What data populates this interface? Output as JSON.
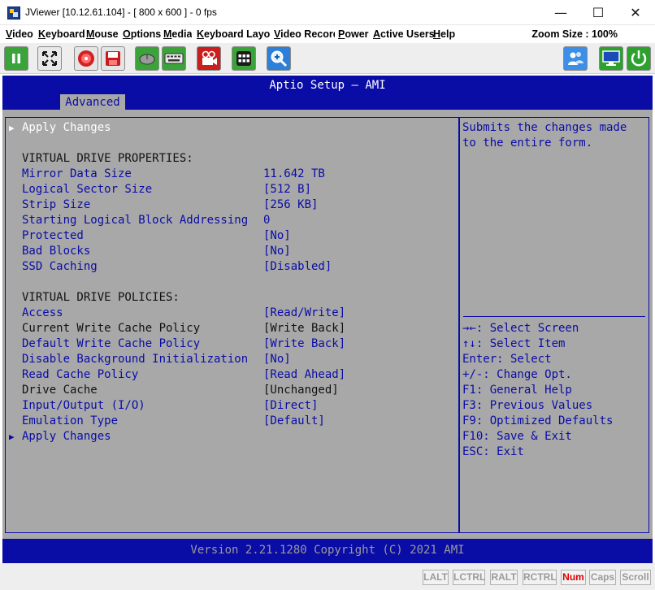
{
  "window": {
    "title": "JViewer [10.12.61.104] - [ 800 x 600 ] - 0 fps",
    "minimize_glyph": "—",
    "maximize_glyph": "☐",
    "close_glyph": "✕"
  },
  "menu": {
    "items": [
      "Video",
      "Keyboard",
      "Mouse",
      "Options",
      "Media",
      "Keyboard Layout",
      "Video Record",
      "Power",
      "Active Users",
      "Help"
    ],
    "zoom": "Zoom Size : 100%"
  },
  "toolbar": {
    "icons": [
      "pause-icon",
      "fullscreen-icon",
      "cd-media-icon",
      "floppy-media-icon",
      "mouse-icon",
      "keyboard-icon",
      "video-record-icon",
      "macro-keys-icon",
      "zoom-icon",
      "users-icon",
      "display-icon",
      "power-icon"
    ]
  },
  "bios": {
    "header": "Aptio Setup – AMI",
    "tab": "Advanced",
    "rows": [
      {
        "label": "Apply Changes",
        "value": "",
        "arrow": true,
        "color": "white"
      },
      {
        "label": "VIRTUAL DRIVE PROPERTIES:",
        "value": "",
        "arrow": false,
        "color": "black"
      },
      {
        "label": "Mirror Data Size",
        "value": "11.642 TB",
        "arrow": false,
        "color": "blue"
      },
      {
        "label": "Logical Sector Size",
        "value": "[512 B]",
        "arrow": false,
        "color": "blue"
      },
      {
        "label": "Strip Size",
        "value": "[256 KB]",
        "arrow": false,
        "color": "blue"
      },
      {
        "label": "Starting Logical Block Addressing",
        "value": "0",
        "arrow": false,
        "color": "blue"
      },
      {
        "label": "Protected",
        "value": "[No]",
        "arrow": false,
        "color": "blue"
      },
      {
        "label": "Bad Blocks",
        "value": "[No]",
        "arrow": false,
        "color": "blue"
      },
      {
        "label": "SSD Caching",
        "value": "[Disabled]",
        "arrow": false,
        "color": "blue"
      },
      {
        "label": "VIRTUAL DRIVE POLICIES:",
        "value": "",
        "arrow": false,
        "color": "black"
      },
      {
        "label": "Access",
        "value": "[Read/Write]",
        "arrow": false,
        "color": "blue"
      },
      {
        "label": "Current Write Cache Policy",
        "value": "[Write Back]",
        "arrow": false,
        "color": "black"
      },
      {
        "label": "Default Write Cache Policy",
        "value": "[Write Back]",
        "arrow": false,
        "color": "blue"
      },
      {
        "label": "Disable Background Initialization",
        "value": "[No]",
        "arrow": false,
        "color": "blue"
      },
      {
        "label": "Read Cache Policy",
        "value": "[Read Ahead]",
        "arrow": false,
        "color": "blue"
      },
      {
        "label": "Drive Cache",
        "value": "[Unchanged]",
        "arrow": false,
        "color": "black"
      },
      {
        "label": "Input/Output (I/O)",
        "value": "[Direct]",
        "arrow": false,
        "color": "blue"
      },
      {
        "label": "Emulation Type",
        "value": "[Default]",
        "arrow": false,
        "color": "blue"
      },
      {
        "label": "Apply Changes",
        "value": "",
        "arrow": true,
        "color": "blue"
      }
    ],
    "help_text": [
      "Submits the changes made",
      "to the entire form."
    ],
    "keys": [
      "→←: Select Screen",
      "↑↓: Select Item",
      "Enter: Select",
      "+/-: Change Opt.",
      "F1: General Help",
      "F3: Previous Values",
      "F9: Optimized Defaults",
      "F10: Save & Exit",
      "ESC: Exit"
    ],
    "footer": "Version 2.21.1280 Copyright (C) 2021 AMI"
  },
  "status": {
    "keys": [
      {
        "label": "LALT",
        "active": false
      },
      {
        "label": "LCTRL",
        "active": false
      },
      {
        "label": "RALT",
        "active": false
      },
      {
        "label": "RCTRL",
        "active": false
      },
      {
        "label": "Num",
        "active": true
      },
      {
        "label": "Caps",
        "active": false
      },
      {
        "label": "Scroll",
        "active": false
      }
    ]
  },
  "colors": {
    "bios_blue": "#0a0ca6",
    "bios_gray": "#a8a8a8",
    "num_lock_on": "#e00000"
  }
}
